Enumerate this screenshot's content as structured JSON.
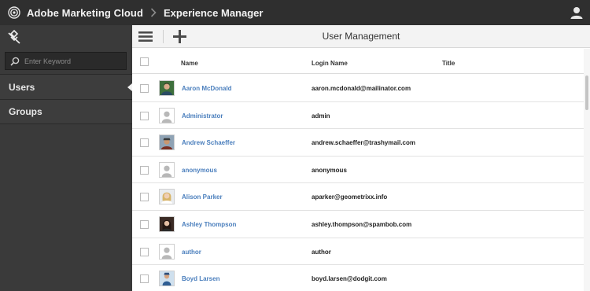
{
  "header": {
    "brand": "Adobe Marketing Cloud",
    "product": "Experience Manager",
    "icons": {
      "logo": "adobe-marketing-cloud-logo",
      "separator": "chevron-right-icon",
      "user": "user-icon"
    }
  },
  "sidebar": {
    "search": {
      "placeholder": "Enter Keyword",
      "value": ""
    },
    "items": [
      {
        "label": "Users",
        "active": true
      },
      {
        "label": "Groups",
        "active": false
      }
    ]
  },
  "toolbar": {
    "title": "User Management",
    "icons": {
      "rail": "rail-toggle-icon",
      "add": "add-icon"
    }
  },
  "table": {
    "columns": {
      "name": "Name",
      "login": "Login Name",
      "title": "Title"
    },
    "rows": [
      {
        "name": "Aaron McDonald",
        "login": "aaron.mcdonald@mailinator.com",
        "title": "",
        "avatar": "photo"
      },
      {
        "name": "Administrator",
        "login": "admin",
        "title": "",
        "avatar": "placeholder"
      },
      {
        "name": "Andrew Schaeffer",
        "login": "andrew.schaeffer@trashymail.com",
        "title": "",
        "avatar": "photo"
      },
      {
        "name": "anonymous",
        "login": "anonymous",
        "title": "",
        "avatar": "placeholder"
      },
      {
        "name": "Alison Parker",
        "login": "aparker@geometrixx.info",
        "title": "",
        "avatar": "photo"
      },
      {
        "name": "Ashley Thompson",
        "login": "ashley.thompson@spambob.com",
        "title": "",
        "avatar": "photo"
      },
      {
        "name": "author",
        "login": "author",
        "title": "",
        "avatar": "placeholder"
      },
      {
        "name": "Boyd Larsen",
        "login": "boyd.larsen@dodgit.com",
        "title": "",
        "avatar": "photo"
      }
    ]
  },
  "colors": {
    "topbar": "#2f2f2f",
    "sidebar": "#3a3a3a",
    "link": "#4b7fbd",
    "toolbar": "#f3f3f3"
  }
}
